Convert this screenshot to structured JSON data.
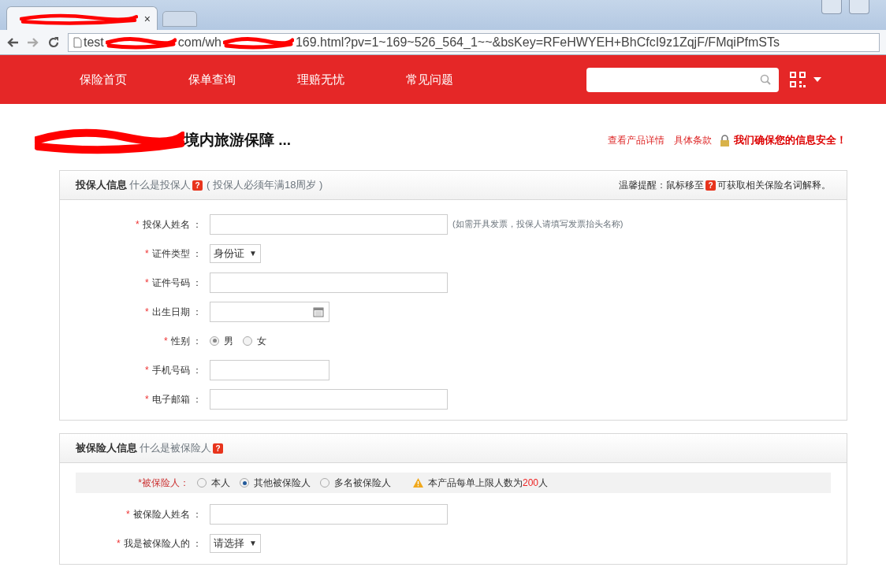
{
  "browser": {
    "tab": {
      "redacted": true,
      "close": "×"
    },
    "address": {
      "parts": [
        {
          "kind": "text",
          "text": "test"
        },
        {
          "kind": "redacted"
        },
        {
          "kind": "text",
          "text": "com/wh"
        },
        {
          "kind": "redacted"
        },
        {
          "kind": "text",
          "text": "169.html?pv=1~169~526_564_1~~&bsKey=RFeHWYEH+BhCfcI9z1ZqjF/FMqiPfmSTs"
        }
      ]
    }
  },
  "nav": {
    "items": [
      {
        "label": "保险首页"
      },
      {
        "label": "保单查询"
      },
      {
        "label": "理赔无忧"
      },
      {
        "label": "常见问题"
      }
    ]
  },
  "title": {
    "redacted": true,
    "text": "境内旅游保障 ..."
  },
  "header_links": [
    "查看产品详情",
    "具体条款"
  ],
  "security_note": "我们确保您的信息安全！",
  "sections": [
    {
      "title": "投保人信息",
      "help_link": "什么是投保人",
      "help_icon": "?",
      "note": "( 投保人必须年满18周岁 )",
      "tip": {
        "prefix": "温馨提醒：鼠标移至",
        "icon": "?",
        "suffix": "可获取相关保险名词解释。"
      },
      "fields": [
        {
          "kind": "text",
          "required": "*",
          "label": "投保人姓名 ：",
          "hint": "(如需开具发票，投保人请填写发票抬头名称)"
        },
        {
          "kind": "select",
          "required": "*",
          "label": "证件类型 ：",
          "value": "身份证",
          "caret": "▼"
        },
        {
          "kind": "text",
          "required": "*",
          "label": "证件号码 ："
        },
        {
          "kind": "date",
          "required": "*",
          "label": "出生日期 ："
        },
        {
          "kind": "radio",
          "required": "*",
          "label": "性别 ：",
          "options": [
            {
              "label": "男",
              "selected": true
            },
            {
              "label": "女",
              "selected": false
            }
          ]
        },
        {
          "kind": "short_text",
          "required": "*",
          "label": "手机号码 ："
        },
        {
          "kind": "text",
          "required": "*",
          "label": "电子邮箱 ："
        }
      ]
    },
    {
      "title": "被保险人信息",
      "help_link": "什么是被保险人",
      "help_icon": "?",
      "choice": {
        "label": "*被保险人：",
        "options": [
          {
            "label": "本人",
            "selected": false
          },
          {
            "label": "其他被保险人",
            "selected": true
          },
          {
            "label": "多名被保险人",
            "selected": false
          }
        ],
        "notice": {
          "prefix": "本产品每单上限人数为",
          "count": "200",
          "suffix": "人"
        }
      },
      "fields": [
        {
          "kind": "text",
          "required": "*",
          "label": "被保险人姓名 ："
        },
        {
          "kind": "select",
          "required": "*",
          "label": "我是被保险人的 ：",
          "value": "请选择",
          "caret": "▼"
        }
      ]
    }
  ]
}
